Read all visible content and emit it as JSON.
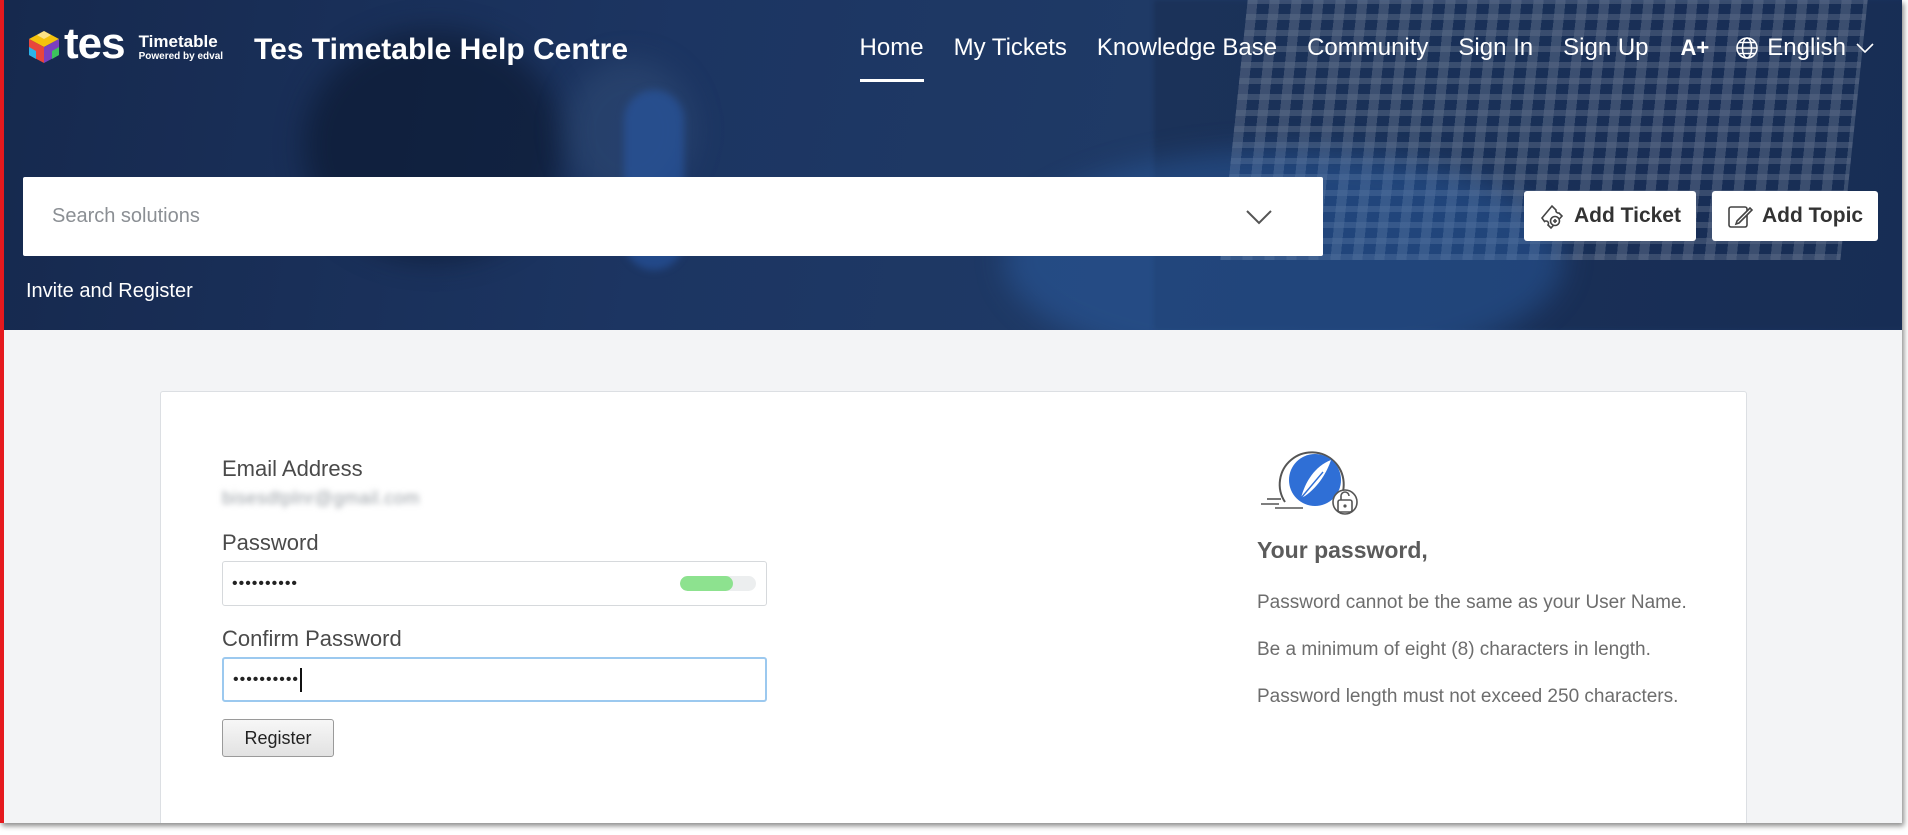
{
  "header": {
    "logo": {
      "brand": "tes",
      "product": "Timetable",
      "powered_by": "Powered by edval"
    },
    "site_title": "Tes Timetable Help Centre",
    "nav": [
      {
        "label": "Home",
        "active": true
      },
      {
        "label": "My Tickets"
      },
      {
        "label": "Knowledge Base"
      },
      {
        "label": "Community"
      },
      {
        "label": "Sign In"
      },
      {
        "label": "Sign Up"
      }
    ],
    "font_size_icon": "A+",
    "language": "English"
  },
  "search": {
    "placeholder": "Search solutions"
  },
  "actions": {
    "add_ticket": "Add Ticket",
    "add_topic": "Add Topic"
  },
  "breadcrumb": "Invite and Register",
  "form": {
    "email_label": "Email Address",
    "email_value": "bisesdtplnr@gmail.com",
    "password_label": "Password",
    "password_value": "••••••••••",
    "password_strength": 0.7,
    "confirm_label": "Confirm Password",
    "confirm_value": "••••••••••",
    "register_label": "Register"
  },
  "rules": {
    "title": "Your password,",
    "items": [
      "Password cannot be the same as your User Name.",
      "Be a minimum of eight (8) characters in length.",
      "Password length must not exceed 250 characters."
    ]
  },
  "colors": {
    "header_bg": "#1c3562",
    "accent_border": "#e5191e",
    "strength_fill": "#8de28f",
    "page_bg": "#f3f4f6",
    "rules_icon_blue": "#2f6fd6"
  }
}
